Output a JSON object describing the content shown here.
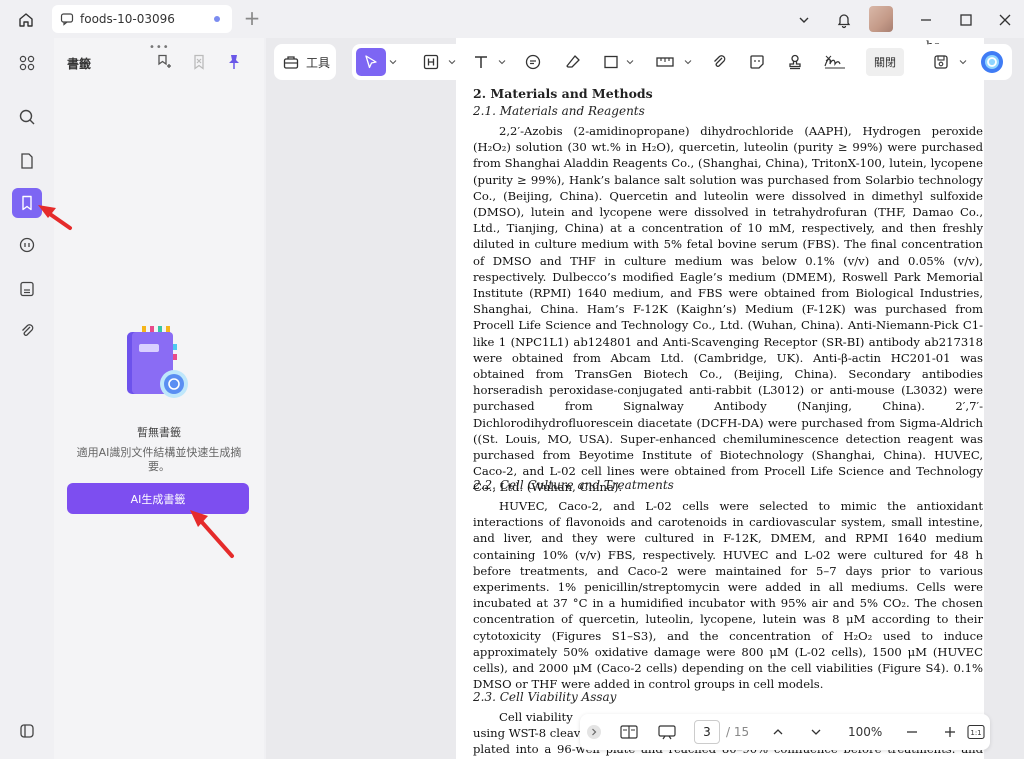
{
  "titlebar": {
    "tab_title": "foods-10-03096",
    "add_tab": "+"
  },
  "panel": {
    "title": "書籤",
    "dots": "•••",
    "empty_title": "暫無書籤",
    "empty_desc": "適用AI識別文件結構並快速生成摘要。",
    "ai_button": "AI生成書籤"
  },
  "toolbar": {
    "tools_label": "工具",
    "close_label": "關閉"
  },
  "document": {
    "top_fragment_1": "he",
    "top_fragment_2": "oc",
    "sec2_title": "2. Materials and Methods",
    "sec21_title": "2.1. Materials and Reagents",
    "sec21_text": "2,2′-Azobis (2-amidinopropane) dihydrochloride (AAPH), Hydrogen peroxide (H₂O₂) solution (30 wt.% in H₂O), quercetin, luteolin (purity ≥ 99%) were purchased from Shanghai Aladdin Reagents Co., (Shanghai, China), TritonX-100, lutein, lycopene (purity ≥ 99%), Hank’s balance salt solution was purchased from Solarbio technology Co., (Beijing, China). Quercetin and luteolin were dissolved in dimethyl sulfoxide (DMSO), lutein and lycopene were dissolved in tetrahydrofuran (THF, Damao Co., Ltd., Tianjing, China) at a concentration of 10 mM, respectively, and then freshly diluted in culture medium with 5% fetal bovine serum (FBS). The final concentration of DMSO and THF in culture medium was below 0.1% (v/v) and 0.05% (v/v), respectively. Dulbecco’s modified Eagle’s medium (DMEM), Roswell Park Memorial Institute (RPMI) 1640 medium, and FBS were obtained from Biological Industries, Shanghai, China. Ham’s F-12K (Kaighn’s) Medium (F-12K) was purchased from Procell Life Science and Technology Co., Ltd. (Wuhan, China). Anti-Niemann-Pick C1-like 1 (NPC1L1) ab124801 and Anti-Scavenging Receptor (SR-BI) antibody ab217318 were obtained from Abcam Ltd. (Cambridge, UK). Anti-β-actin HC201-01 was obtained from TransGen Biotech Co., (Beijing, China). Secondary antibodies horseradish peroxidase-conjugated anti-rabbit (L3012) or anti-mouse (L3032) were purchased from Signalway Antibody (Nanjing, China). 2′,7′-Dichlorodihydrofluorescein diacetate (DCFH-DA) were purchased from Sigma-Aldrich ((St. Louis, MO, USA). Super-enhanced chemiluminescence detection reagent was purchased from Beyotime Institute of Biotechnology (Shanghai, China). HUVEC, Caco-2, and L-02 cell lines were obtained from Procell Life Science and Technology Co., Ltd. (Wuhan, China).",
    "sec22_title": "2.2. Cell Culture and Treatments",
    "sec22_text": "HUVEC, Caco-2, and L-02 cells were selected to mimic the antioxidant interactions of flavonoids and carotenoids in cardiovascular system, small intestine, and liver, and they were cultured in F-12K, DMEM, and RPMI 1640 medium containing 10% (v/v) FBS, respectively. HUVEC and L-02 were cultured for 48 h before treatments, and Caco-2 were maintained for 5–7 days prior to various experiments. 1% penicillin/streptomycin were added in all mediums. Cells were incubated at 37 °C in a humidified incubator with 95% air and 5% CO₂. The chosen concentration of quercetin, luteolin, lycopene, lutein was 8 μM according to their cytotoxicity (Figures S1–S3), and the concentration of H₂O₂ used to induce approximately 50% oxidative damage were 800 μM (L-02 cells), 1500 μM (HUVEC cells), and 2000 μM (Caco-2 cells) depending on the cell viabilities (Figure S4). 0.1% DMSO or THF were added in control groups in cell models.",
    "sec23_title": "2.3. Cell Viability Assay",
    "sec23_line1": "Cell viability",
    "sec23_line2": "using WST-8 cleav",
    "sec23_line3": "plated into a 96-well plate and reached 80–90% confluence before treatments. and 100 μL of"
  },
  "bottom_bar": {
    "page_current": "3",
    "page_total": "/ 15",
    "zoom": "100%"
  },
  "colors": {
    "accent": "#7d66f3",
    "ai_button": "#7d4ef0"
  }
}
